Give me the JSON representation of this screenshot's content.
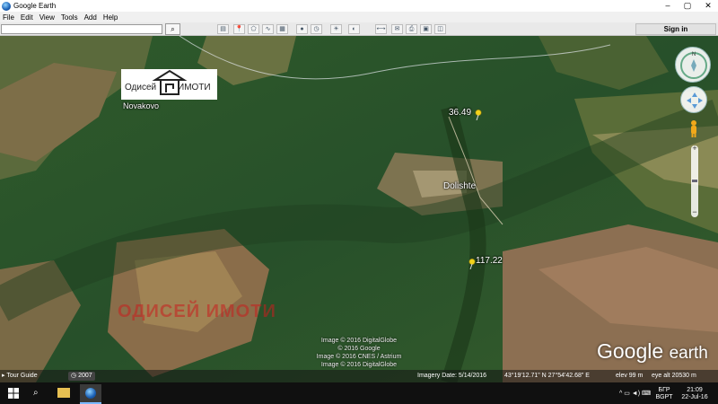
{
  "window": {
    "title": "Google Earth",
    "minimize": "–",
    "maximize": "▢",
    "close": "✕"
  },
  "menu": [
    "File",
    "Edit",
    "View",
    "Tools",
    "Add",
    "Help"
  ],
  "search": {
    "value": "",
    "button_icon": "search-icon"
  },
  "toolbar_icons": [
    "sidebar-icon",
    "placemark-icon",
    "polygon-icon",
    "path-icon",
    "image-overlay-icon",
    "record-tour-icon",
    "historical-imagery-icon",
    "sunlight-icon",
    "planets-icon",
    "ruler-icon",
    "email-icon",
    "print-icon",
    "save-image-icon",
    "maps-icon"
  ],
  "signin_label": "Sign in",
  "map": {
    "logo": {
      "text_left": "Одисей",
      "text_right": "ИМОТИ"
    },
    "places": [
      {
        "label": "Novakovo"
      },
      {
        "label": "Dolishte"
      }
    ],
    "pins": [
      {
        "label": "36.49"
      },
      {
        "label": "117.22"
      }
    ],
    "watermark": "ОДИСЕЙ ИМОТИ",
    "credits": [
      "Image © 2016 DigitalGlobe",
      "© 2016 Google",
      "Image © 2016 CNES / Astrium",
      "Image © 2016 DigitalGlobe"
    ],
    "brand_google": "Google",
    "brand_earth": "earth"
  },
  "status": {
    "tour_guide": "Tour Guide",
    "year": "2007",
    "imagery_date": "Imagery Date: 5/14/2016",
    "coords": "43°19'12.71\" N  27°54'42.68\" E",
    "elev": "elev   99 m",
    "eye_alt": "eye alt  20530 m"
  },
  "taskbar": {
    "lang": "БГР",
    "lang2": "BGPT",
    "time": "21:09",
    "date": "22-Jul-16"
  },
  "colors": {
    "forest": "#2d5a2a",
    "field": "#6a5a3c",
    "pin": "#f2d21a"
  }
}
